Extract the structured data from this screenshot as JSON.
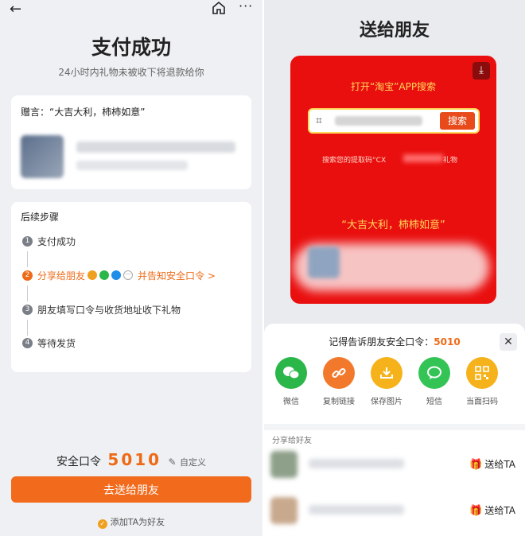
{
  "left": {
    "title": "支付成功",
    "subtitle": "24小时内礼物未被收下将退款给你",
    "message": "赠言：“大吉大利，柿柿如意”",
    "steps_title": "后续步骤",
    "steps": [
      {
        "num": "1",
        "label": "支付成功",
        "active": false
      },
      {
        "num": "2",
        "label": "分享给朋友",
        "suffix": "并告知安全口令 >",
        "active": true
      },
      {
        "num": "3",
        "label": "朋友填写口令与收货地址收下礼物",
        "active": false
      },
      {
        "num": "4",
        "label": "等待发货",
        "active": false
      }
    ],
    "code_label": "安全口令",
    "code_value": "5010",
    "edit_label": "自定义",
    "give_button": "去送给朋友",
    "add_friend": "添加TA为好友"
  },
  "right": {
    "title": "送给朋友",
    "red_head": "打开“淘宝”APP搜索",
    "search_button": "搜索",
    "hint_prefix": "搜索您的提取码“CX",
    "hint_suffix": "礼物",
    "red_message": "“大吉大利，柿柿如意”",
    "sheet_title_prefix": "记得告诉朋友安全口令：",
    "sheet_code": "5010",
    "share_items": [
      {
        "label": "微信",
        "color": "#2bb64a",
        "icon": "wechat-icon"
      },
      {
        "label": "复制链接",
        "color": "#f2792c",
        "icon": "link-icon"
      },
      {
        "label": "保存图片",
        "color": "#f6b21b",
        "icon": "download-icon"
      },
      {
        "label": "短信",
        "color": "#34c456",
        "icon": "message-icon"
      },
      {
        "label": "当面扫码",
        "color": "#f6b21b",
        "icon": "qrcode-icon"
      }
    ],
    "share_friends_title": "分享给好友",
    "gift_label": "送给TA"
  }
}
